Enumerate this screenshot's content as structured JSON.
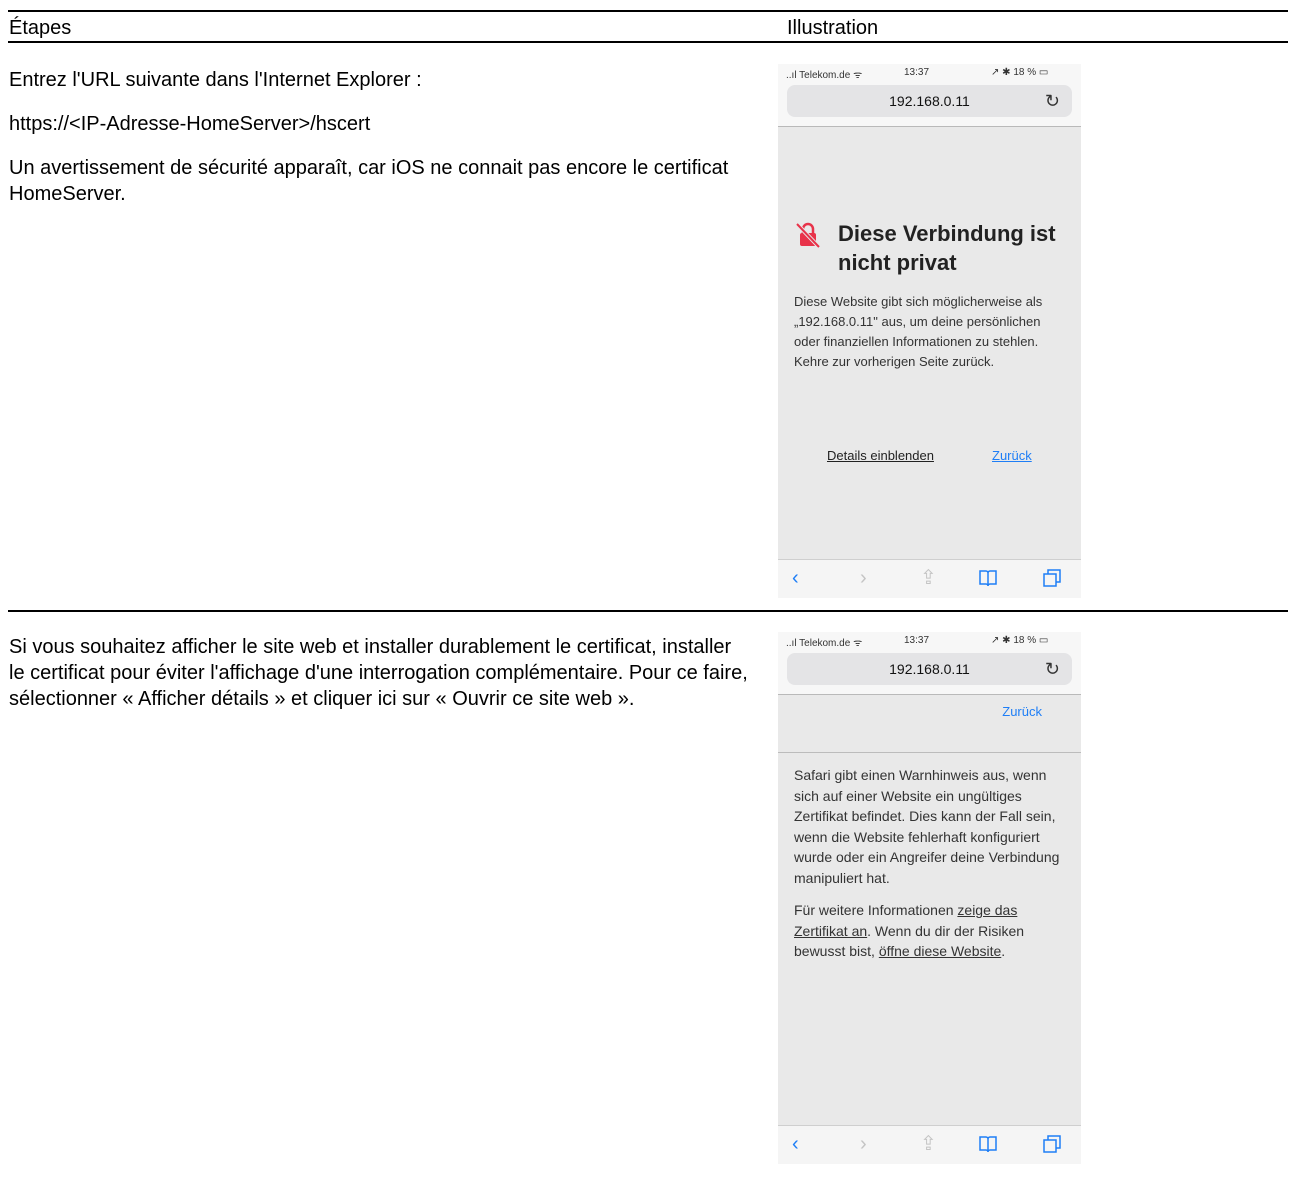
{
  "table": {
    "col_steps": "Étapes",
    "col_illustration": "Illustration"
  },
  "step1": {
    "line1": "Entrez l'URL suivante dans l'Internet Explorer :",
    "line2": "https://<IP-Adresse-HomeServer>/hscert",
    "line3": "Un avertissement de sécurité apparaît, car iOS ne connait pas encore le certificat HomeServer."
  },
  "step2": {
    "text": "Si vous souhaitez afficher le site web et installer durablement le certificat, installer le certificat pour éviter l'affichage d'une interrogation complémentaire. Pour ce faire, sélectionner « Afficher détails » et cliquer ici sur « Ouvrir ce site web »."
  },
  "phone_common": {
    "carrier": "..ıl Telekom.de ᯤ",
    "time": "13:37",
    "battery": "↗ ✱ 18 % ▭",
    "address": "192.168.0.11",
    "toolbar": {
      "back": "‹",
      "forward": "›",
      "share": "⇪",
      "bookmarks": "📖",
      "tabs": "⧉"
    }
  },
  "phone1": {
    "title": "Diese Verbindung ist nicht privat",
    "body": "Diese Website gibt sich möglicherweise als „192.168.0.11\" aus, um deine persönlichen oder finanziellen Informationen zu stehlen. Kehre zur vorherigen Seite zurück.",
    "link_details": "Details einblenden",
    "link_back": "Zurück"
  },
  "phone2": {
    "back_label": "Zurück",
    "para1": "Safari gibt einen Warnhinweis aus, wenn sich auf einer Website ein ungültiges Zertifikat befindet. Dies kann der Fall sein, wenn die Website fehlerhaft konfiguriert wurde oder ein Angreifer deine Verbindung manipuliert hat.",
    "para2_a": "Für weitere Informationen ",
    "para2_link1": "zeige das Zertifikat an",
    "para2_b": ". Wenn du dir der Risiken bewusst bist, ",
    "para2_link2": "öffne diese Website",
    "para2_c": "."
  }
}
